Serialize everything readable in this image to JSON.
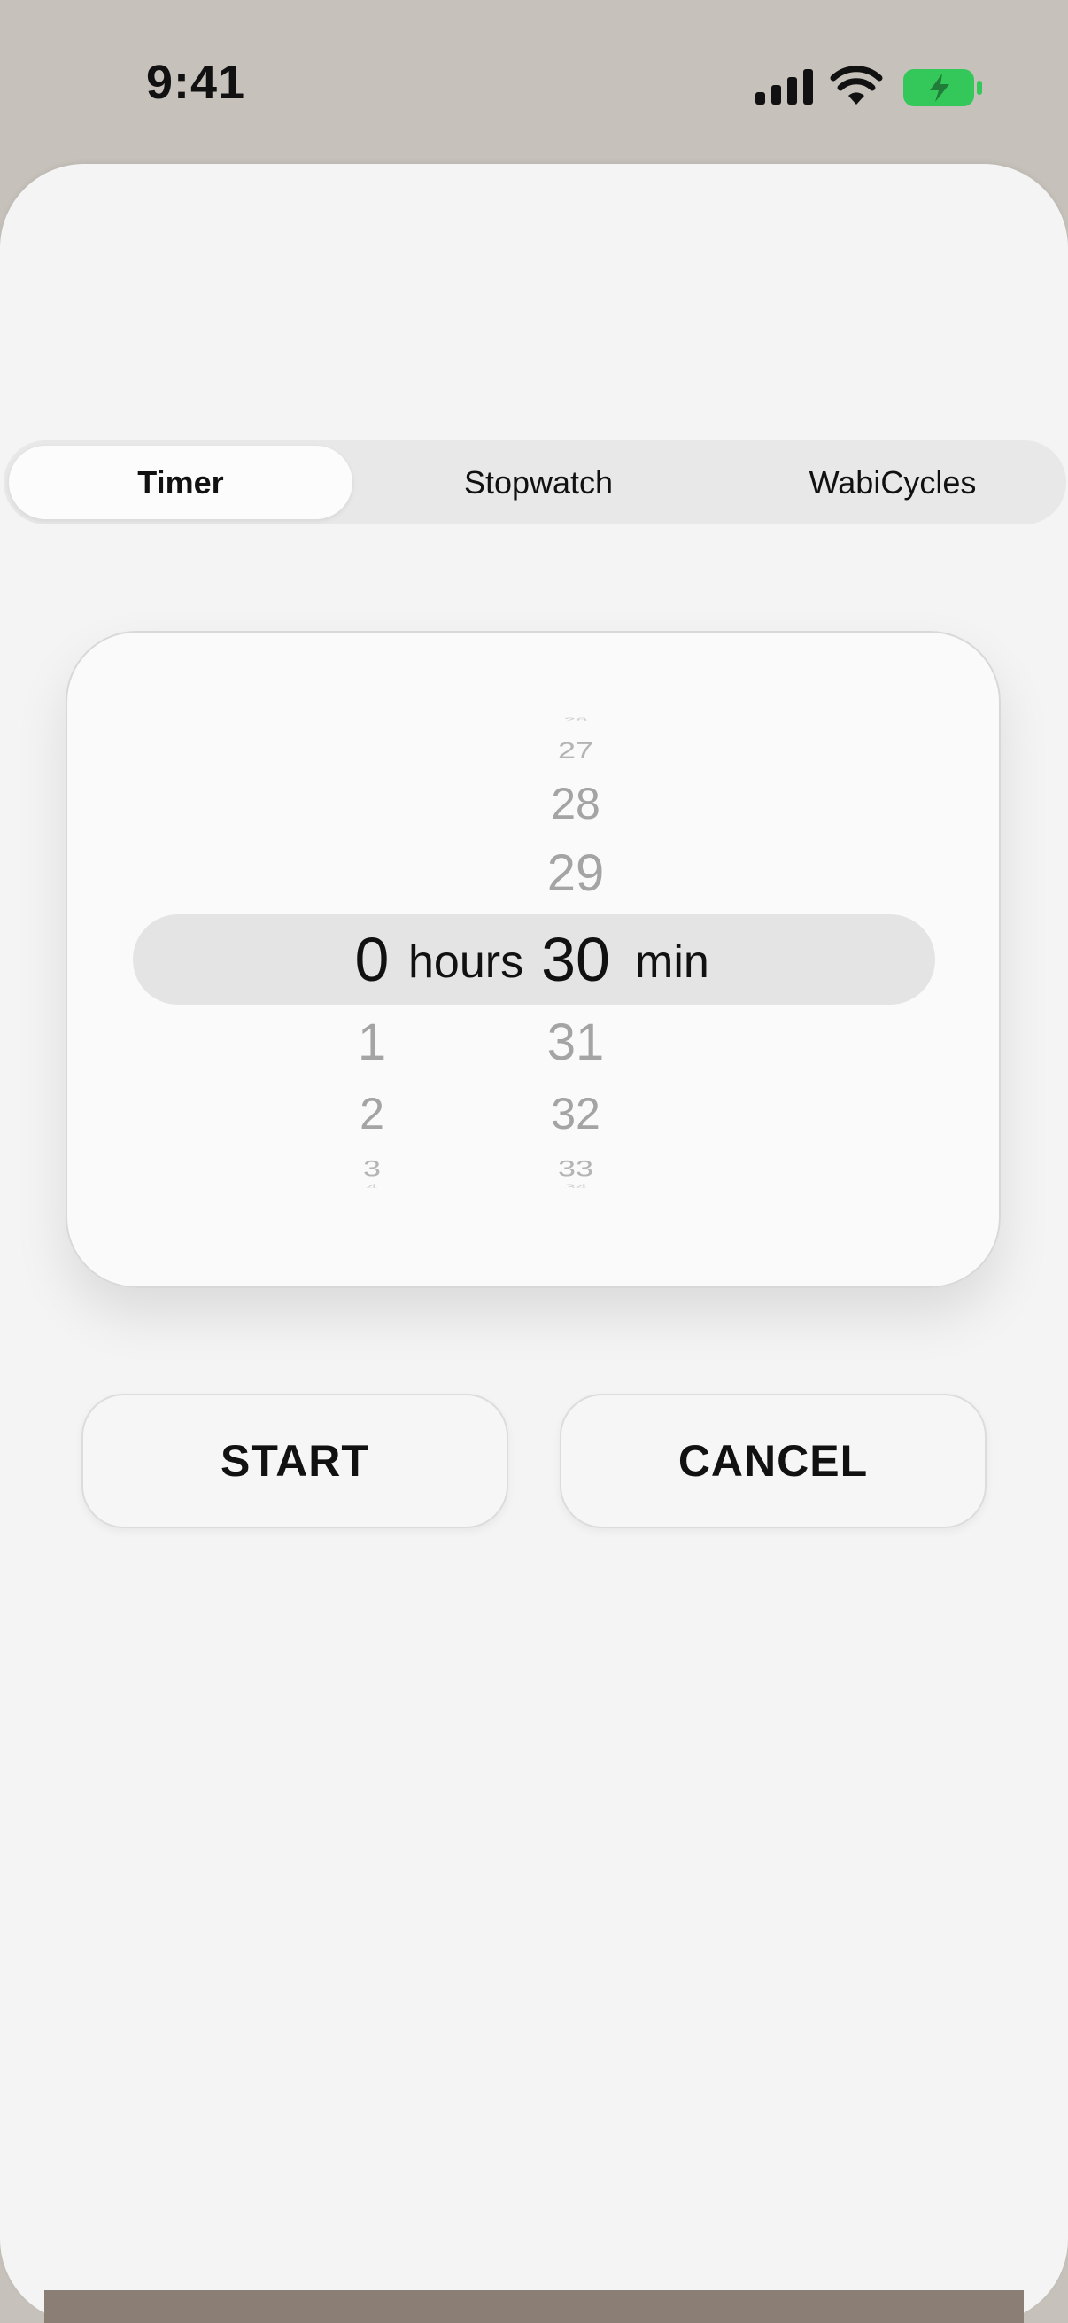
{
  "status_bar": {
    "time": "9:41",
    "battery_color": "#34c759"
  },
  "tabs": [
    {
      "label": "Timer",
      "selected": true
    },
    {
      "label": "Stopwatch",
      "selected": false
    },
    {
      "label": "WabiCycles",
      "selected": false
    }
  ],
  "picker": {
    "hours": {
      "above": [],
      "selected": "0",
      "below": [
        "1",
        "2",
        "3",
        "4"
      ],
      "unit": "hours"
    },
    "minutes": {
      "above": [
        "26",
        "27",
        "28",
        "29"
      ],
      "selected": "30",
      "below": [
        "31",
        "32",
        "33",
        "34"
      ],
      "unit": "min"
    }
  },
  "buttons": {
    "start": "START",
    "cancel": "CANCEL"
  }
}
